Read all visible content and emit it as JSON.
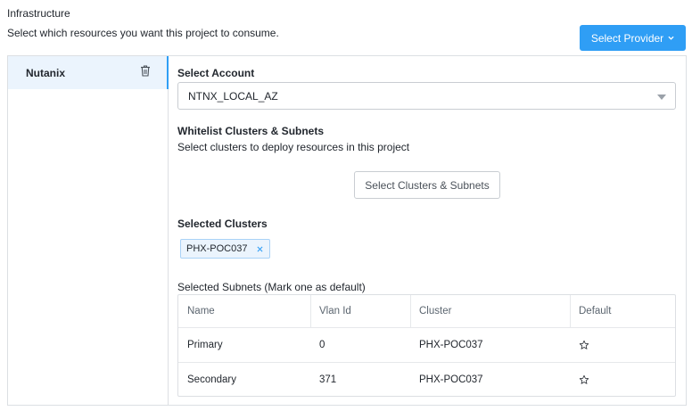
{
  "header": {
    "title": "Infrastructure",
    "subtitle": "Select which resources you want this project to consume.",
    "provider_button_label": "Select Provider"
  },
  "providers": [
    {
      "label": "Nutanix",
      "active": true
    }
  ],
  "account": {
    "label": "Select Account",
    "value": "NTNX_LOCAL_AZ"
  },
  "whitelist": {
    "title": "Whitelist Clusters & Subnets",
    "description": "Select clusters to deploy resources in this project",
    "button_label": "Select Clusters & Subnets"
  },
  "selected_clusters": {
    "title": "Selected Clusters",
    "tags": [
      "PHX-POC037"
    ]
  },
  "subnets": {
    "title": "Selected Subnets (Mark one as default)",
    "columns": [
      "Name",
      "Vlan Id",
      "Cluster",
      "Default"
    ],
    "rows": [
      {
        "name": "Primary",
        "vlan": "0",
        "cluster": "PHX-POC037",
        "default": false
      },
      {
        "name": "Secondary",
        "vlan": "371",
        "cluster": "PHX-POC037",
        "default": false
      }
    ]
  },
  "colors": {
    "accent": "#2f9ef5",
    "active_bg": "#ebf4fd",
    "border": "#dcdfe3"
  },
  "icons": {
    "provider_dropdown": "chevron-down-icon",
    "provider_delete": "trash-icon",
    "account_caret": "caret-down-icon",
    "tag_remove": "close-icon",
    "default_marker": "star-outline-icon"
  }
}
